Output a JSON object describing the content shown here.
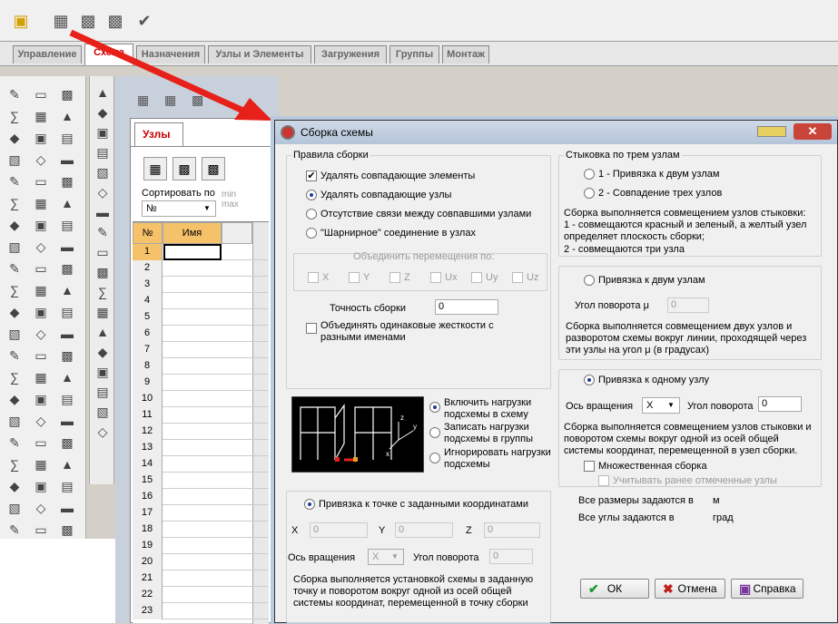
{
  "toolbar": {
    "icons": [
      "folder-open-icon",
      "grid-icon",
      "table-icon",
      "table-edit-icon",
      "checkmark-icon"
    ]
  },
  "tabs": [
    "Управление",
    "Схема",
    "Назначения",
    "Узлы и Элементы",
    "Загружения",
    "Группы",
    "Монтаж"
  ],
  "nodes_panel": {
    "tab": "Узлы",
    "sort_label": "Сортировать по",
    "sort_value": "№",
    "min_max": "min max",
    "col_no": "№",
    "col_name": "Имя",
    "rows": [
      "1",
      "2",
      "3",
      "4",
      "5",
      "6",
      "7",
      "8",
      "9",
      "10",
      "11",
      "12",
      "13",
      "14",
      "15",
      "16",
      "17",
      "18",
      "19",
      "20",
      "21",
      "22",
      "23"
    ]
  },
  "dialog": {
    "title": "Сборка схемы",
    "assembly_rules": {
      "title": "Правила сборки",
      "delete_elements": "Удалять совпадающие элементы",
      "delete_nodes": "Удалять совпадающие узлы",
      "no_link": "Отсутствие связи между совпавшими узлами",
      "hinge": "\"Шарнирное\" соединение в узлах"
    },
    "merge": {
      "title": "Объединить перемещения по:",
      "axes": [
        "X",
        "Y",
        "Z",
        "Ux",
        "Uy",
        "Uz"
      ]
    },
    "precision_label": "Точность сборки",
    "precision_value": "0",
    "merge_stiff": "Объединять одинаковые жесткости с разными именами",
    "loads": {
      "include": "Включить нагрузки подсхемы в схему",
      "write": "Записать нагрузки подсхемы в группы",
      "ignore": "Игнорировать нагрузки подсхемы"
    },
    "three_nodes": {
      "title": "Стыковка по трем узлам",
      "opt1": "1 - Привязка к двум узлам",
      "opt2": "2 - Совпадение трех узлов",
      "desc1": "Сборка выполняется совмещением узлов стыковки:",
      "desc2": "1 - совмещаются красный и зеленый, а желтый узел",
      "desc3": "определяет плоскость сборки;",
      "desc4": "2 - совмещаются три узла"
    },
    "two_nodes": {
      "title": "Привязка к двум узлам",
      "angle_label": "Угол поворота μ",
      "angle_value": "0",
      "desc1": "Сборка выполняется совмещением двух узлов и",
      "desc2": "разворотом схемы вокруг линии, проходящей через",
      "desc3": "эти узлы  на угол μ (в градусах)"
    },
    "one_node": {
      "title": "Привязка к одному узлу",
      "axis_label": "Ось вращения",
      "axis_value": "X",
      "angle_label": "Угол поворота",
      "angle_value": "0",
      "desc1": "Сборка выполняется совмещением узлов стыковки и",
      "desc2": "поворотом схемы вокруг одной из осей общей",
      "desc3": "системы координат, перемещенной в узел сборки.",
      "multi": "Множественная сборка",
      "consider": "Учитывать ранее отмеченные узлы"
    },
    "coords": {
      "title": "Привязка к точке с заданными координатами",
      "x": "X",
      "y": "Y",
      "z": "Z",
      "xv": "0",
      "yv": "0",
      "zv": "0",
      "axis_label": "Ось вращения",
      "axis_value": "X",
      "angle_label": "Угол поворота",
      "angle_value": "0",
      "desc1": "Сборка выполняется установкой схемы в заданную",
      "desc2": "точку и поворотом вокруг одной из осей общей",
      "desc3": "системы координат, перемещенной в точку сборки"
    },
    "units": {
      "sizes": "Все размеры задаются в",
      "sizes_unit": "м",
      "angles": "Все углы задаются в",
      "angles_unit": "град"
    },
    "buttons": {
      "ok": "ОК",
      "cancel": "Отмена",
      "help": "Справка"
    }
  },
  "colors": {
    "arrow": "#e8201a",
    "accent": "#1a3c9a"
  }
}
